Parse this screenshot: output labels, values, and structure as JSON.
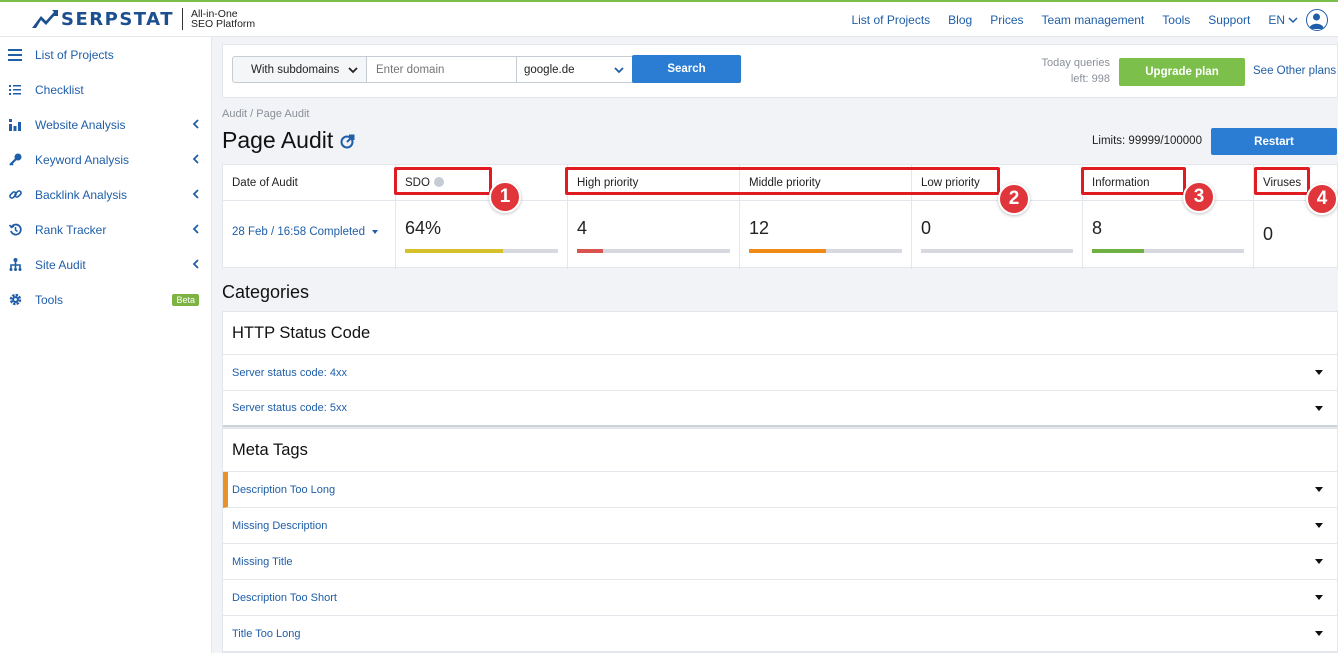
{
  "header": {
    "brand": "SERPSTAT",
    "tagline_line1": "All-in-One",
    "tagline_line2": "SEO Platform",
    "nav": [
      "List of Projects",
      "Blog",
      "Prices",
      "Team management",
      "Tools",
      "Support"
    ],
    "language": "EN"
  },
  "sidebar": {
    "items": [
      {
        "label": "List of Projects",
        "icon": "menu-icon"
      },
      {
        "label": "Checklist",
        "icon": "checklist-icon"
      },
      {
        "label": "Website Analysis",
        "icon": "bar-chart-icon"
      },
      {
        "label": "Keyword Analysis",
        "icon": "key-icon"
      },
      {
        "label": "Backlink Analysis",
        "icon": "link-icon"
      },
      {
        "label": "Rank Tracker",
        "icon": "history-icon"
      },
      {
        "label": "Site Audit",
        "icon": "sitemap-icon"
      },
      {
        "label": "Tools",
        "icon": "gear-icon"
      }
    ],
    "beta_label": "Beta"
  },
  "search": {
    "scope": "With subdomains",
    "domain_placeholder": "Enter domain",
    "engine": "google.de",
    "search_label": "Search",
    "queries_line1": "Today queries",
    "queries_line2": "left: 998",
    "upgrade_label": "Upgrade plan",
    "plans_link": "See Other plans"
  },
  "page": {
    "breadcrumb": "Audit / Page Audit",
    "title": "Page Audit",
    "limits": "Limits: 99999/100000",
    "restart_label": "Restart"
  },
  "stats": {
    "date_header": "Date of Audit",
    "date_value": "28 Feb / 16:58 Completed",
    "columns": [
      {
        "header": "SDO",
        "value": "64%",
        "fill": 0.64,
        "color": "#d6c12a"
      },
      {
        "header": "High priority",
        "value": "4",
        "fill": 0.17,
        "color": "#d9534f"
      },
      {
        "header": "Middle priority",
        "value": "12",
        "fill": 0.5,
        "color": "#ef8a17"
      },
      {
        "header": "Low priority",
        "value": "0",
        "fill": 0,
        "color": "#d6dae0"
      },
      {
        "header": "Information",
        "value": "8",
        "fill": 0.34,
        "color": "#6fb043"
      },
      {
        "header": "Viruses",
        "value": "0",
        "fill": 0,
        "color": "#d6dae0"
      }
    ]
  },
  "annotations": [
    "1",
    "2",
    "3",
    "4"
  ],
  "categories": {
    "title": "Categories",
    "groups": [
      {
        "name": "HTTP Status Code",
        "rows": [
          "Server status code: 4xx",
          "Server status code: 5xx"
        ]
      },
      {
        "name": "Meta Tags",
        "rows": [
          "Description Too Long",
          "Missing Description",
          "Missing Title",
          "Description Too Short",
          "Title Too Long"
        ]
      }
    ]
  },
  "colors": {
    "accent": "#1f5ea8",
    "button": "#2a7dd2",
    "upgrade": "#7cc04b",
    "annotation": "#e01b22"
  }
}
